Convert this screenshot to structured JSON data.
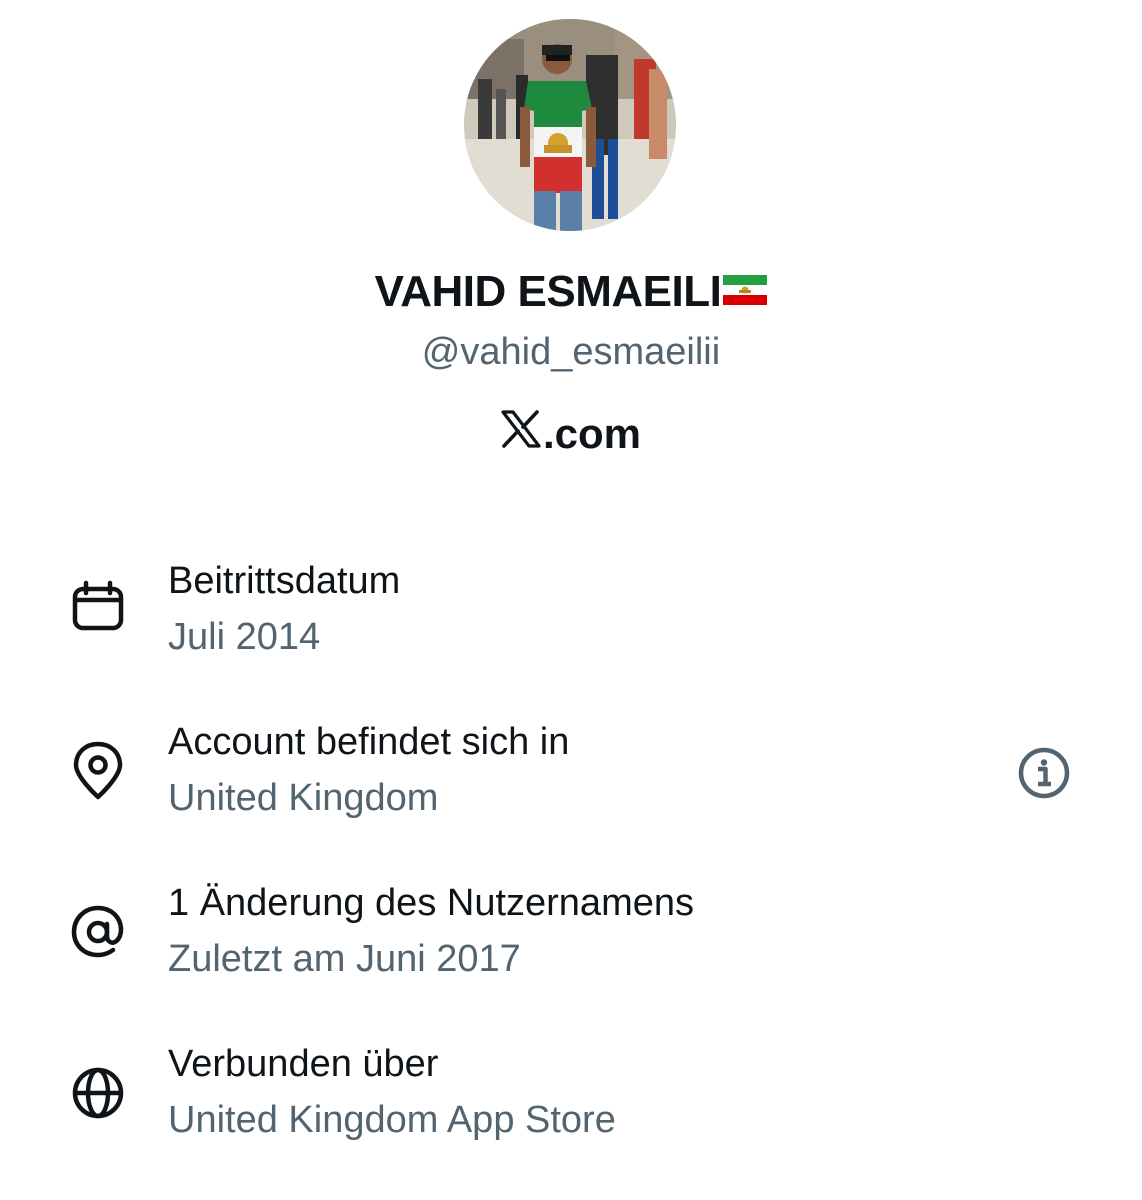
{
  "profile": {
    "display_name": "VAHID ESMAEILI",
    "handle": "@vahid_esmaeilii",
    "site": ".com",
    "avatar_icon": "profile-photo",
    "flag_icon": "iran-lion-and-sun-flag-icon"
  },
  "about": [
    {
      "icon": "calendar-icon",
      "title": "Beitrittsdatum",
      "value": "Juli 2014"
    },
    {
      "icon": "location-pin-icon",
      "title": "Account befindet sich in",
      "value": "United Kingdom"
    },
    {
      "icon": "at-sign-icon",
      "title": "1 Änderung des Nutzernamens",
      "value": "Zuletzt am Juni 2017"
    },
    {
      "icon": "globe-icon",
      "title": "Verbunden über",
      "value": "United Kingdom App Store"
    }
  ],
  "colors": {
    "primary_text": "#0f1419",
    "secondary_text": "#536471",
    "background": "#ffffff"
  }
}
